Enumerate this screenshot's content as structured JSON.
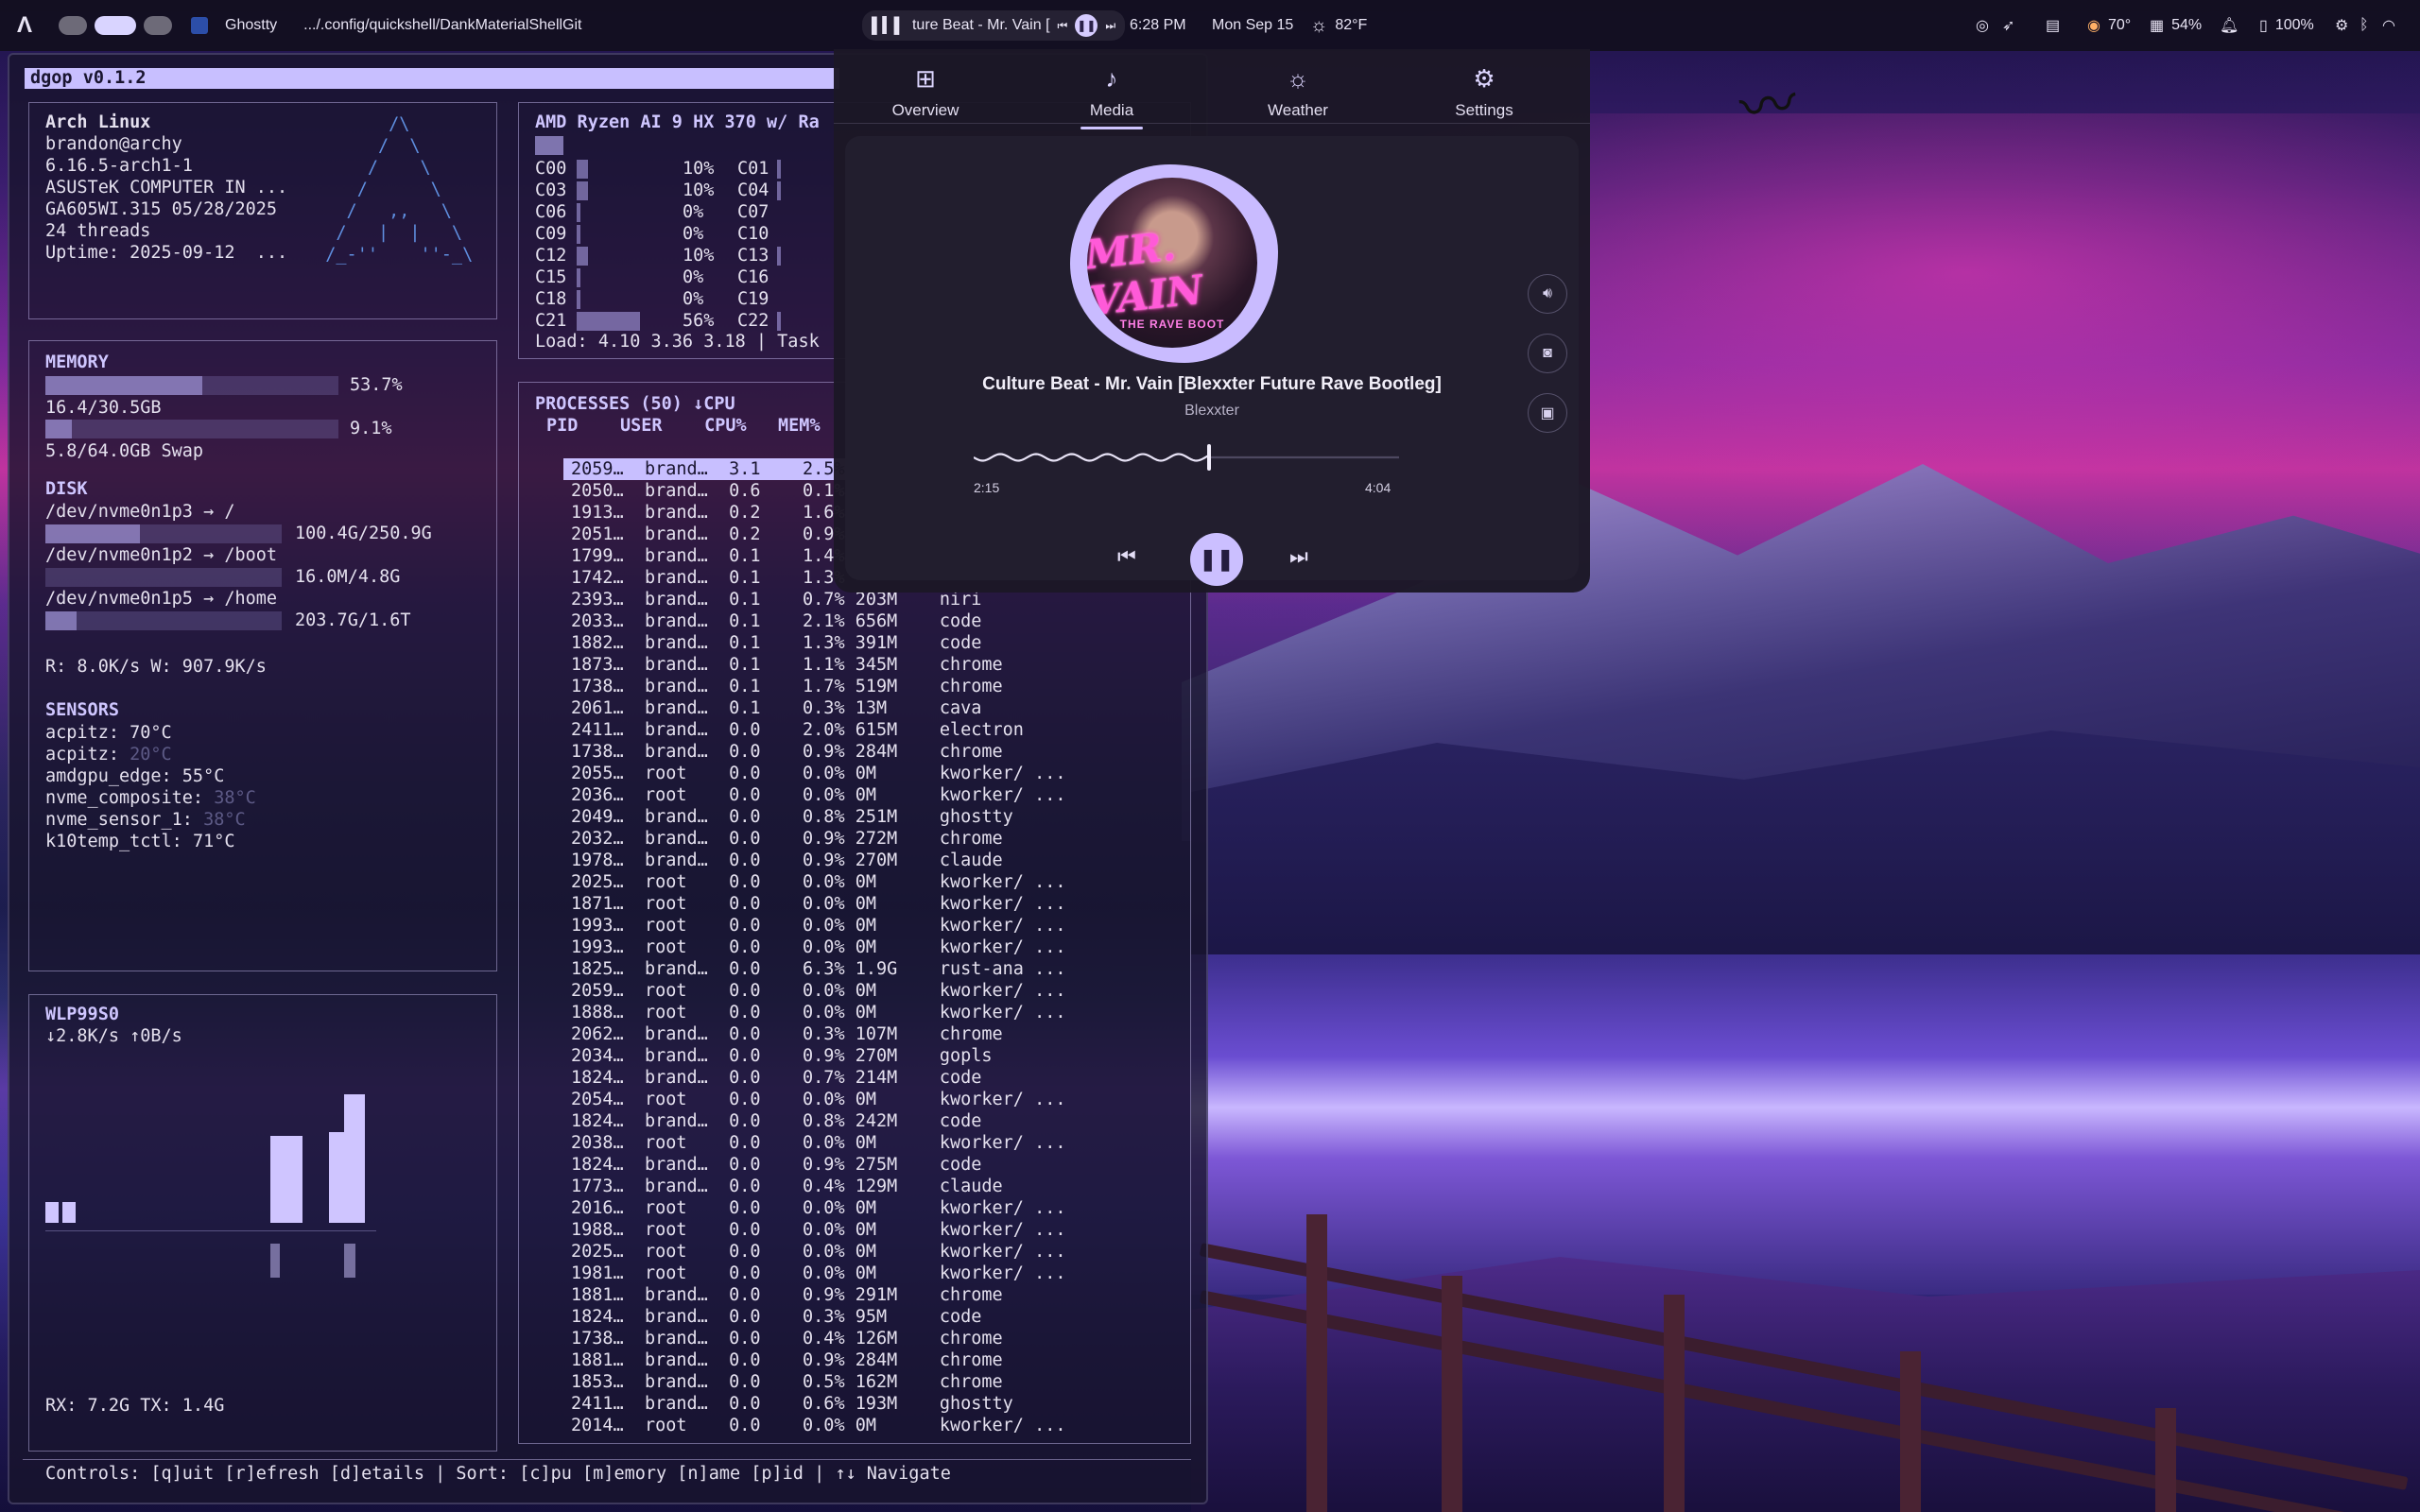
{
  "topbar": {
    "window_app": "Ghostty",
    "window_title": ".../.config/quickshell/DankMaterialShellGit",
    "media_title": "ture Beat - Mr. Vain [",
    "clock": "6:28 PM",
    "date": "Mon Sep 15",
    "weather_temp": "82°F",
    "cpu_temp": "70°",
    "mem_percent": "54%",
    "battery": "100%"
  },
  "terminal": {
    "title": "dgop v0.1.2",
    "sysinfo": [
      "Arch Linux",
      "brandon@archy",
      "6.16.5-arch1-1",
      "ASUSTeK COMPUTER IN ...",
      "GA605WI.315 05/28/2025",
      "24 threads",
      "Uptime: 2025-09-12  ..."
    ],
    "arch_logo": [
      "        /\\",
      "       /  \\",
      "      /    \\",
      "     /      \\",
      "    /   ,,   \\",
      "   /   |  |   \\",
      "  /_-''    ''-_\\"
    ],
    "cpu_header": "AMD Ryzen AI 9 HX 370 w/ Ra",
    "cores": [
      {
        "l": "C00",
        "v": "10%",
        "r": "C01",
        "f": 0.1
      },
      {
        "l": "C03",
        "v": "10%",
        "r": "C04",
        "f": 0.1
      },
      {
        "l": "C06",
        "v": "0%",
        "r": "C07",
        "f": 0
      },
      {
        "l": "C09",
        "v": "0%",
        "r": "C10",
        "f": 0
      },
      {
        "l": "C12",
        "v": "10%",
        "r": "C13",
        "f": 0.1
      },
      {
        "l": "C15",
        "v": "0%",
        "r": "C16",
        "f": 0
      },
      {
        "l": "C18",
        "v": "0%",
        "r": "C19",
        "f": 0
      },
      {
        "l": "C21",
        "v": "56%",
        "r": "C22",
        "f": 0.56
      }
    ],
    "load": "Load: 4.10 3.36 3.18 | Task",
    "memory_header": "MEMORY",
    "mem_pct": "53.7%",
    "mem_frac": 0.537,
    "mem_used": "16.4/30.5GB",
    "swap_pct": "9.1%",
    "swap_frac": 0.091,
    "swap_used": "5.8/64.0GB Swap",
    "disk_header": "DISK",
    "disks": [
      {
        "name": "/dev/nvme0n1p3 → /",
        "usage": "100.4G/250.9G",
        "frac": 0.4
      },
      {
        "name": "/dev/nvme0n1p2 → /boot",
        "usage": "16.0M/4.8G",
        "frac": 0.0
      },
      {
        "name": "/dev/nvme0n1p5 → /home",
        "usage": "203.7G/1.6T",
        "frac": 0.13
      }
    ],
    "disk_io": "R: 8.0K/s W: 907.9K/s",
    "sensors_header": "SENSORS",
    "sensors": [
      {
        "name": "acpitz: ",
        "val": "70°C",
        "dim": false
      },
      {
        "name": "acpitz: ",
        "val": "20°C",
        "dim": true
      },
      {
        "name": "amdgpu_edge: ",
        "val": "55°C",
        "dim": false
      },
      {
        "name": "nvme_composite: ",
        "val": "38°C",
        "dim": true
      },
      {
        "name": "nvme_sensor_1: ",
        "val": "38°C",
        "dim": true
      },
      {
        "name": "k10temp_tctl: ",
        "val": "71°C",
        "dim": false
      }
    ],
    "net_header": "WLP99S0",
    "net_rate": "↓2.8K/s ↑0B/s",
    "net_total": "RX: 7.2G TX: 1.4G",
    "proc_header": "PROCESSES (50) ↓CPU",
    "proc_cols": "PID    USER    CPU%   MEM%",
    "processes": [
      "2059…  brand…  3.1    2.5%",
      "2050…  brand…  0.6    0.1%",
      "1913…  brand…  0.2    1.6%",
      "2051…  brand…  0.2    0.9%",
      "1799…  brand…  0.1    1.4%",
      "1742…  brand…  0.1    1.3%",
      "2393…  brand…  0.1    0.7% 203M    niri",
      "2033…  brand…  0.1    2.1% 656M    code",
      "1882…  brand…  0.1    1.3% 391M    code",
      "1873…  brand…  0.1    1.1% 345M    chrome",
      "1738…  brand…  0.1    1.7% 519M    chrome",
      "2061…  brand…  0.1    0.3% 13M     cava",
      "2411…  brand…  0.0    2.0% 615M    electron",
      "1738…  brand…  0.0    0.9% 284M    chrome",
      "2055…  root    0.0    0.0% 0M      kworker/ ...",
      "2036…  root    0.0    0.0% 0M      kworker/ ...",
      "2049…  brand…  0.0    0.8% 251M    ghostty",
      "2032…  brand…  0.0    0.9% 272M    chrome",
      "1978…  brand…  0.0    0.9% 270M    claude",
      "2025…  root    0.0    0.0% 0M      kworker/ ...",
      "1871…  root    0.0    0.0% 0M      kworker/ ...",
      "1993…  root    0.0    0.0% 0M      kworker/ ...",
      "1993…  root    0.0    0.0% 0M      kworker/ ...",
      "1825…  brand…  0.0    6.3% 1.9G    rust-ana ...",
      "2059…  root    0.0    0.0% 0M      kworker/ ...",
      "1888…  root    0.0    0.0% 0M      kworker/ ...",
      "2062…  brand…  0.0    0.3% 107M    chrome",
      "2034…  brand…  0.0    0.9% 270M    gopls",
      "1824…  brand…  0.0    0.7% 214M    code",
      "2054…  root    0.0    0.0% 0M      kworker/ ...",
      "1824…  brand…  0.0    0.8% 242M    code",
      "2038…  root    0.0    0.0% 0M      kworker/ ...",
      "1824…  brand…  0.0    0.9% 275M    code",
      "1773…  brand…  0.0    0.4% 129M    claude",
      "2016…  root    0.0    0.0% 0M      kworker/ ...",
      "1988…  root    0.0    0.0% 0M      kworker/ ...",
      "2025…  root    0.0    0.0% 0M      kworker/ ...",
      "1981…  root    0.0    0.0% 0M      kworker/ ...",
      "1881…  brand…  0.0    0.9% 291M    chrome",
      "1824…  brand…  0.0    0.3% 95M     code",
      "1738…  brand…  0.0    0.4% 126M    chrome",
      "1881…  brand…  0.0    0.9% 284M    chrome",
      "1853…  brand…  0.0    0.5% 162M    chrome",
      "2411…  brand…  0.0    0.6% 193M    ghostty",
      "2014…  root    0.0    0.0% 0M      kworker/ ..."
    ],
    "controls": "Controls: [q]uit [r]efresh [d]etails | Sort: [c]pu [m]emory [n]ame [p]id | ↑↓ Navigate"
  },
  "control_center": {
    "tabs": [
      {
        "label": "Overview",
        "icon": "grid-icon"
      },
      {
        "label": "Media",
        "icon": "music-note-icon"
      },
      {
        "label": "Weather",
        "icon": "sun-icon"
      },
      {
        "label": "Settings",
        "icon": "gear-icon"
      }
    ],
    "active_tab": "Media",
    "album_logo": "MR. VAIN",
    "album_sub": "THE RAVE BOOT",
    "song": "Culture Beat - Mr. Vain [Blexxter Future Rave Bootleg]",
    "artist": "Blexxter",
    "elapsed": "2:15",
    "duration": "4:04",
    "progress": 0.553
  },
  "colors": {
    "accent": "#cfc5ff",
    "selected_row": "#c8bfff"
  }
}
